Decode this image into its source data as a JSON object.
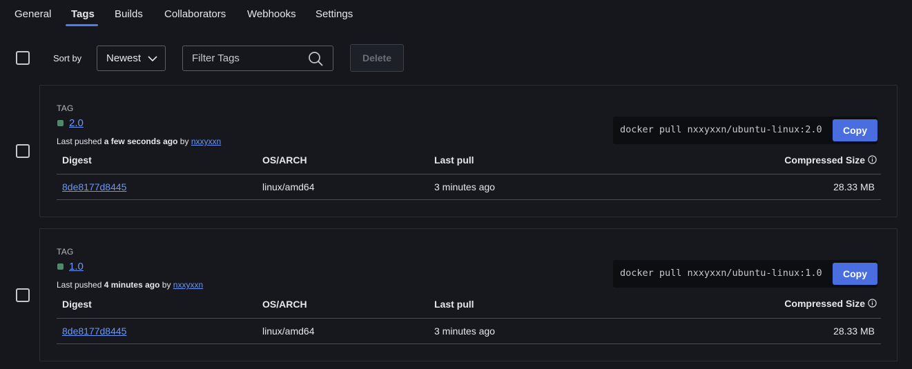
{
  "tabs": [
    {
      "label": "General"
    },
    {
      "label": "Tags"
    },
    {
      "label": "Builds"
    },
    {
      "label": "Collaborators"
    },
    {
      "label": "Webhooks"
    },
    {
      "label": "Settings"
    }
  ],
  "active_tab": "Tags",
  "toolbar": {
    "sort_label": "Sort by",
    "sort_value": "Newest",
    "filter_placeholder": "Filter Tags",
    "delete_label": "Delete"
  },
  "table_headers": {
    "digest": "Digest",
    "os_arch": "OS/ARCH",
    "last_pull": "Last pull",
    "compressed_size": "Compressed Size"
  },
  "tags": [
    {
      "section_label": "TAG",
      "name": "2.0",
      "pushed_prefix": "Last pushed",
      "pushed_time": "a few seconds ago",
      "pushed_by": "by",
      "user": "nxxyxxn",
      "pull_command": "docker pull nxxyxxn/ubuntu-linux:2.0",
      "copy_label": "Copy",
      "row": {
        "digest": "8de8177d8445",
        "os_arch": "linux/amd64",
        "last_pull": "3 minutes ago",
        "size": "28.33 MB"
      }
    },
    {
      "section_label": "TAG",
      "name": "1.0",
      "pushed_prefix": "Last pushed",
      "pushed_time": "4 minutes ago",
      "pushed_by": "by",
      "user": "nxxyxxn",
      "pull_command": "docker pull nxxyxxn/ubuntu-linux:1.0",
      "copy_label": "Copy",
      "row": {
        "digest": "8de8177d8445",
        "os_arch": "linux/amd64",
        "last_pull": "3 minutes ago",
        "size": "28.33 MB"
      }
    }
  ],
  "colors": {
    "accent": "#4c7df0",
    "link": "#6c96f5",
    "copy_button": "#4a6ee0",
    "tag_status": "#4e8a6a",
    "background": "#15171c"
  },
  "icons": {
    "sort_dropdown": "chevron-down-icon",
    "filter": "search-icon",
    "size_info": "info-icon"
  }
}
